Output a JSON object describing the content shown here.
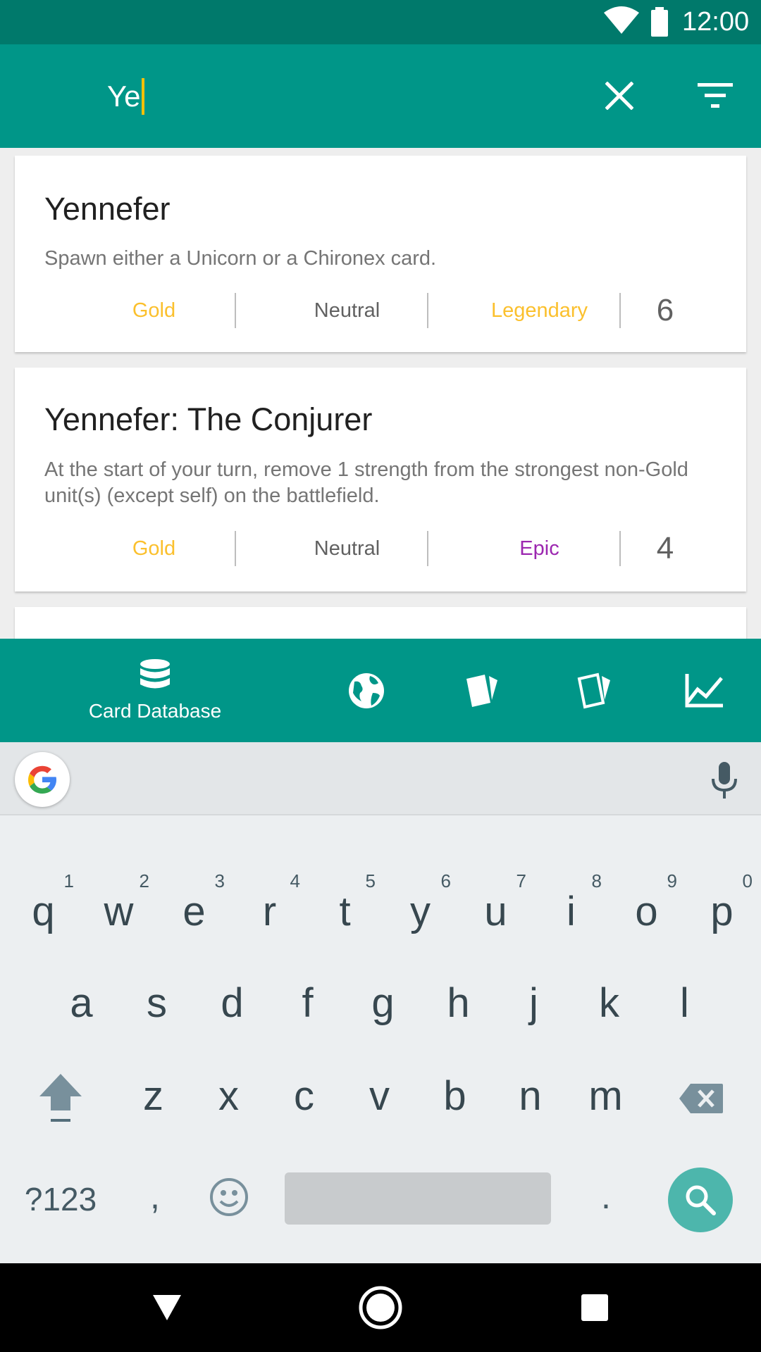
{
  "status_bar": {
    "time": "12:00",
    "icons": [
      "wifi-icon",
      "battery-icon"
    ]
  },
  "search": {
    "query": "Ye",
    "clear_icon": "close-icon",
    "filter_icon": "filter-icon"
  },
  "colors": {
    "primary": "#009688",
    "primary_dark": "#00796b",
    "gold": "#fbc02d",
    "legendary": "#fbc02d",
    "epic": "#9c27b0",
    "neutral": "#616161"
  },
  "cards": [
    {
      "name": "Yennefer",
      "description": "Spawn either a Unicorn or a Chironex card.",
      "type": "Gold",
      "faction": "Neutral",
      "rarity": "Legendary",
      "provision": "6"
    },
    {
      "name": "Yennefer: The Conjurer",
      "description": "At the start of your turn, remove 1 strength from the strongest non-Gold unit(s) (except self) on the battlefield.",
      "type": "Gold",
      "faction": "Neutral",
      "rarity": "Epic",
      "provision": "4"
    }
  ],
  "bottom_nav": {
    "items": [
      {
        "icon": "database-icon",
        "label": "Card Database",
        "active": true
      },
      {
        "icon": "globe-icon",
        "label": ""
      },
      {
        "icon": "cards-icon",
        "label": ""
      },
      {
        "icon": "deck-icon",
        "label": ""
      },
      {
        "icon": "stats-icon",
        "label": ""
      }
    ]
  },
  "keyboard": {
    "row1": [
      {
        "k": "q",
        "h": "1"
      },
      {
        "k": "w",
        "h": "2"
      },
      {
        "k": "e",
        "h": "3"
      },
      {
        "k": "r",
        "h": "4"
      },
      {
        "k": "t",
        "h": "5"
      },
      {
        "k": "y",
        "h": "6"
      },
      {
        "k": "u",
        "h": "7"
      },
      {
        "k": "i",
        "h": "8"
      },
      {
        "k": "o",
        "h": "9"
      },
      {
        "k": "p",
        "h": "0"
      }
    ],
    "row2": [
      "a",
      "s",
      "d",
      "f",
      "g",
      "h",
      "j",
      "k",
      "l"
    ],
    "row3": [
      "z",
      "x",
      "c",
      "v",
      "b",
      "n",
      "m"
    ],
    "symbols_label": "?123",
    "comma": ",",
    "period": "."
  },
  "system_nav": [
    "back-icon",
    "home-icon",
    "recents-icon"
  ]
}
